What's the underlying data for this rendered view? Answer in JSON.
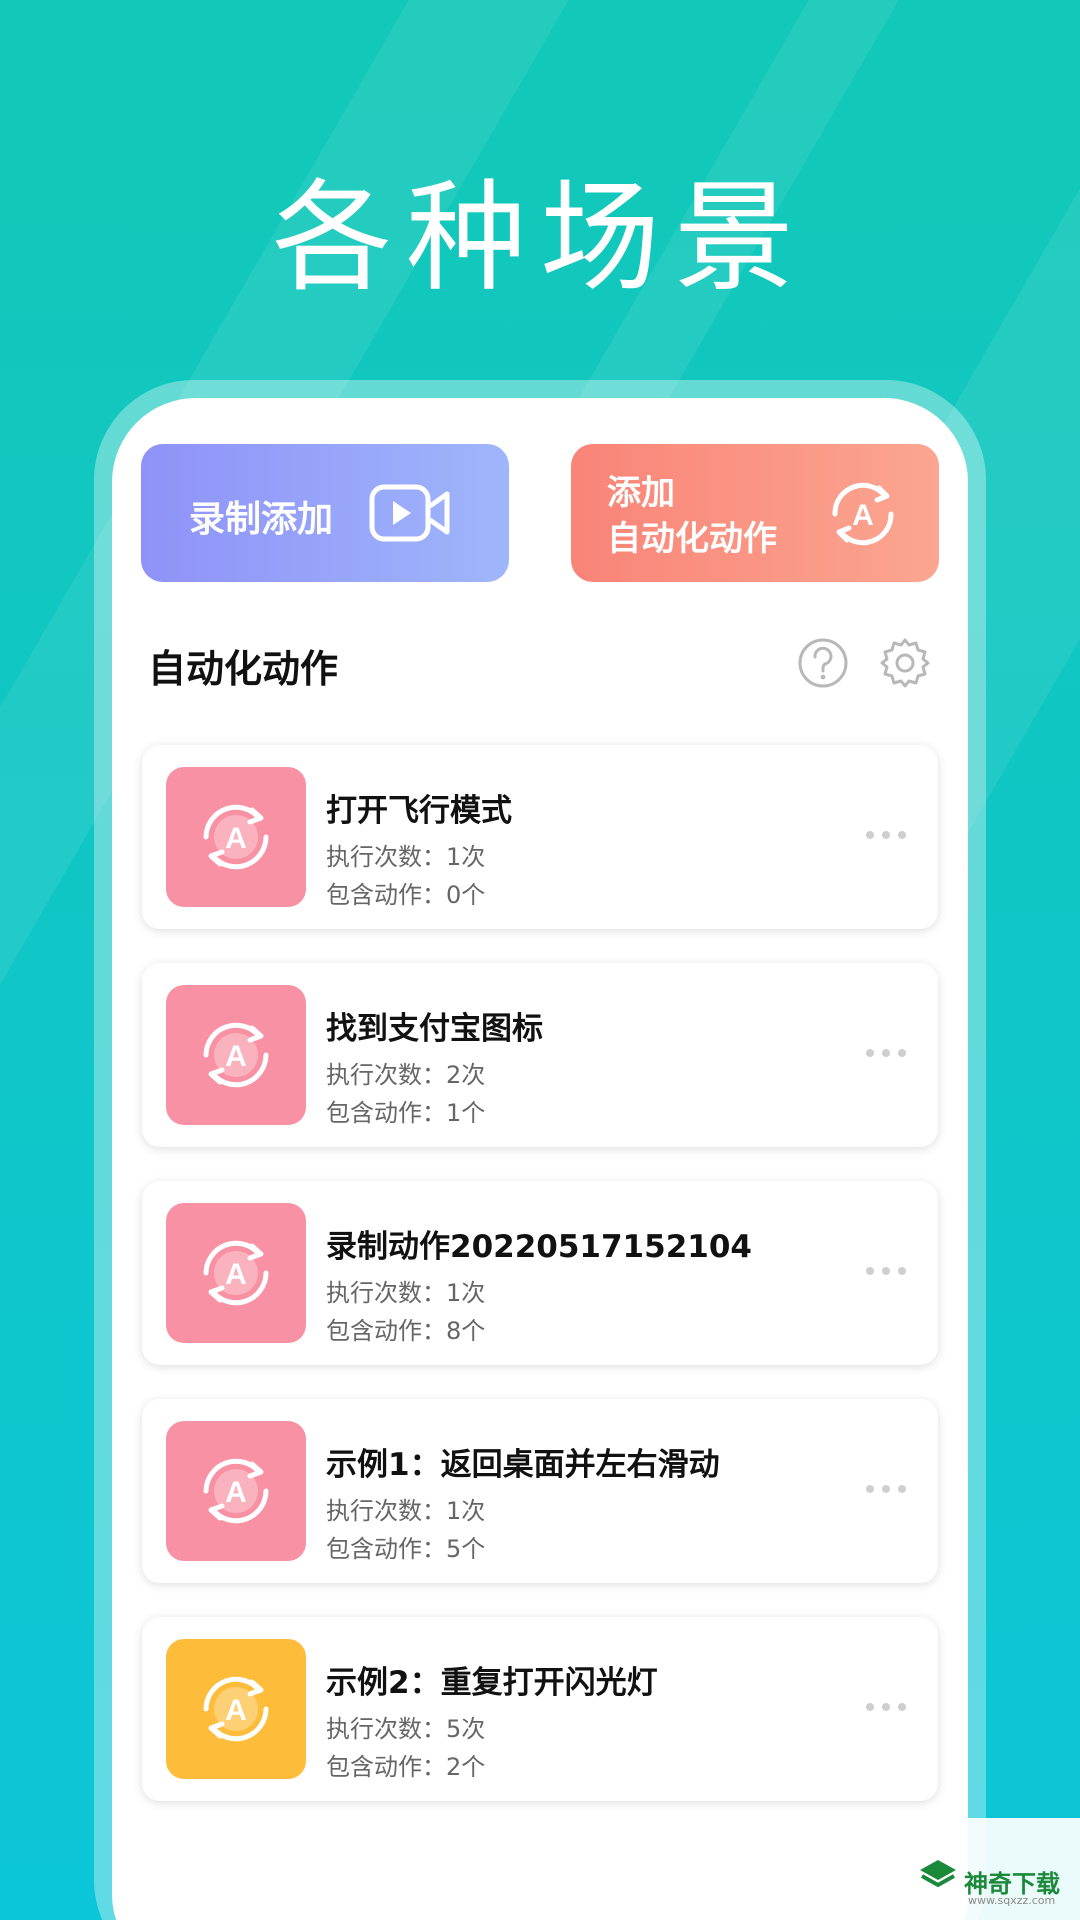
{
  "headline": "各种场景",
  "buttons": {
    "record": {
      "label": "录制添加",
      "icon": "video-play-icon"
    },
    "add": {
      "label_line1": "添加",
      "label_line2": "自动化动作",
      "icon": "automation-a-icon"
    }
  },
  "section": {
    "title": "自动化动作",
    "help_icon": "help-circle-icon",
    "settings_icon": "gear-icon"
  },
  "items": [
    {
      "title": "打开飞行模式",
      "runs": "执行次数：1次",
      "actions": "包含动作：0个",
      "color": "#f891a4"
    },
    {
      "title": "找到支付宝图标",
      "runs": "执行次数：2次",
      "actions": "包含动作：1个",
      "color": "#f891a4"
    },
    {
      "title": "录制动作20220517152104",
      "runs": "执行次数：1次",
      "actions": "包含动作：8个",
      "color": "#f891a4"
    },
    {
      "title": "示例1：返回桌面并左右滑动",
      "runs": "执行次数：1次",
      "actions": "包含动作：5个",
      "color": "#f891a4"
    },
    {
      "title": "示例2：重复打开闪光灯",
      "runs": "执行次数：5次",
      "actions": "包含动作：2个",
      "color": "#fdbc3a"
    }
  ],
  "watermark": {
    "text": "神奇下载",
    "sub": "www.sqxzz.com"
  },
  "colors": {
    "background": "#10c6c6",
    "record_button": "#8f92f8",
    "add_button": "#f98478"
  }
}
